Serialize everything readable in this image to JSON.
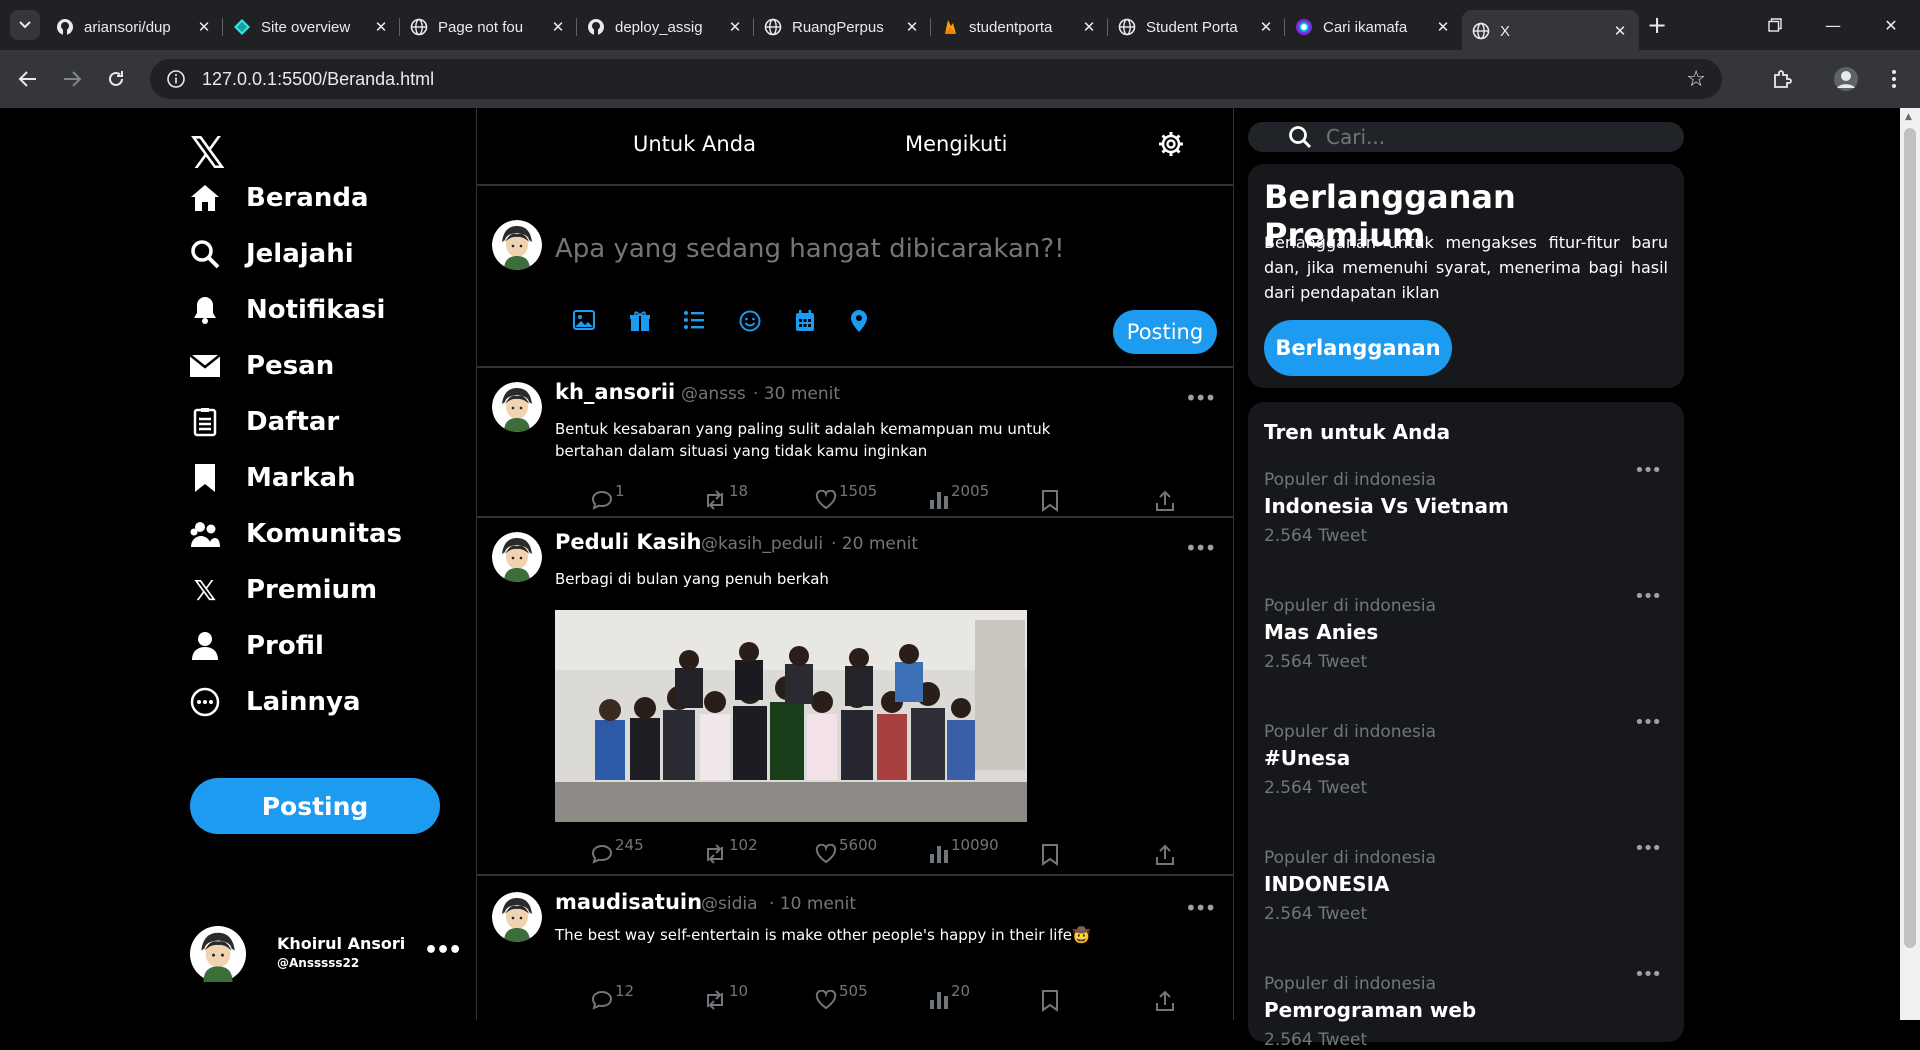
{
  "browser": {
    "tabs": [
      {
        "title": "ariansori/dup",
        "icon": "github-icon"
      },
      {
        "title": "Site overview",
        "icon": "netlify-icon"
      },
      {
        "title": "Page not fou",
        "icon": "globe-icon"
      },
      {
        "title": "deploy_assig",
        "icon": "github-icon"
      },
      {
        "title": "RuangPerpus",
        "icon": "globe-icon"
      },
      {
        "title": "studentporta",
        "icon": "firebase-icon"
      },
      {
        "title": "Student Porta",
        "icon": "globe-icon"
      },
      {
        "title": "Cari ikamafa",
        "icon": "canva-icon"
      },
      {
        "title": "X",
        "icon": "globe-icon"
      }
    ],
    "url": "127.0.0.1:5500/Beranda.html"
  },
  "sidebar": {
    "logo": "𝕏",
    "items": [
      {
        "label": "Beranda",
        "icon": "home-icon"
      },
      {
        "label": "Jelajahi",
        "icon": "search-icon"
      },
      {
        "label": "Notifikasi",
        "icon": "bell-icon"
      },
      {
        "label": "Pesan",
        "icon": "envelope-icon"
      },
      {
        "label": "Daftar",
        "icon": "list-icon"
      },
      {
        "label": "Markah",
        "icon": "bookmark-icon"
      },
      {
        "label": "Komunitas",
        "icon": "community-icon"
      },
      {
        "label": "Premium",
        "icon": "x-icon"
      },
      {
        "label": "Profil",
        "icon": "user-icon"
      },
      {
        "label": "Lainnya",
        "icon": "more-circle-icon"
      }
    ],
    "post_button": "Posting",
    "profile": {
      "name": "Khoirul Ansori",
      "handle": "@Ansssss22",
      "more": "•••"
    }
  },
  "feed": {
    "tabs": [
      "Untuk Anda",
      "Mengikuti"
    ],
    "composer": {
      "placeholder": "Apa yang sedang hangat dibicarakan?!",
      "post_button": "Posting"
    },
    "tweets": [
      {
        "name": "kh_ansorii",
        "handle": "@ansss",
        "time": "· 30 menit",
        "text": "Bentuk kesabaran yang paling sulit adalah kemampuan mu untuk bertahan dalam situasi yang tidak kamu inginkan",
        "replies": "1",
        "retweets": "18",
        "likes": "1505",
        "views": "2005"
      },
      {
        "name": "Peduli Kasih",
        "handle": "@kasih_peduli",
        "time": "· 20 menit",
        "text": "Berbagi di bulan yang penuh berkah",
        "replies": "245",
        "retweets": "102",
        "likes": "5600",
        "views": "10090"
      },
      {
        "name": "maudisatuin",
        "handle": "@sidia",
        "time": "· 10 menit",
        "text": "The best way self-entertain is make other people's happy in their life🤠",
        "replies": "12",
        "retweets": "10",
        "likes": "505",
        "views": "20"
      }
    ]
  },
  "right": {
    "search_placeholder": "Cari...",
    "premium": {
      "title": "Berlangganan Premium",
      "description": "Berlangganan untuk mengakses fitur-fitur baru dan, jika memenuhi syarat, menerima bagi hasil dari pendapatan iklan",
      "button": "Berlangganan"
    },
    "trends_title": "Tren untuk Anda",
    "trends": [
      {
        "category": "Populer di indonesia",
        "name": "Indonesia Vs Vietnam",
        "count": "2.564 Tweet"
      },
      {
        "category": "Populer di indonesia",
        "name": "Mas Anies",
        "count": "2.564 Tweet"
      },
      {
        "category": "Populer di indonesia",
        "name": "#Unesa",
        "count": "2.564 Tweet"
      },
      {
        "category": "Populer di indonesia",
        "name": "INDONESIA",
        "count": "2.564 Tweet"
      },
      {
        "category": "Populer di indonesia",
        "name": "Pemrograman web",
        "count": "2.564 Tweet"
      }
    ]
  },
  "colors": {
    "accent": "#1d9bf0",
    "background": "#000000",
    "card": "#16181c",
    "muted": "#71767b"
  }
}
